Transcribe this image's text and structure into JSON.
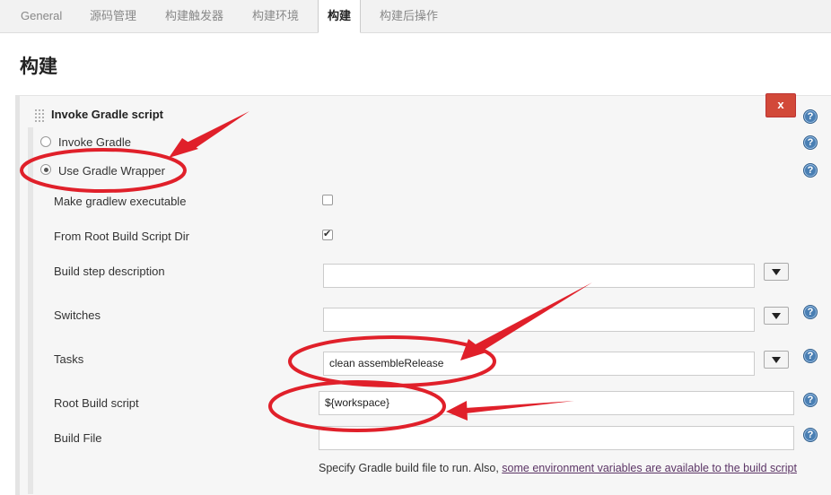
{
  "tabs": [
    {
      "label": "General"
    },
    {
      "label": "源码管理"
    },
    {
      "label": "构建触发器"
    },
    {
      "label": "构建环境"
    },
    {
      "label": "构建"
    },
    {
      "label": "构建后操作"
    }
  ],
  "active_tab": "构建",
  "section_title": "构建",
  "build_step": {
    "title": "Invoke Gradle script",
    "delete_label": "x",
    "options": {
      "invoke_gradle": "Invoke Gradle",
      "use_wrapper": "Use Gradle Wrapper",
      "selected": "Use Gradle Wrapper"
    },
    "make_executable": {
      "label": "Make gradlew executable",
      "checked": false
    },
    "from_root_dir": {
      "label": "From Root Build Script Dir",
      "checked": true,
      "checkmark": "✔"
    },
    "build_step_description": {
      "label": "Build step description",
      "value": ""
    },
    "switches": {
      "label": "Switches",
      "value": ""
    },
    "tasks": {
      "label": "Tasks",
      "value": "clean assembleRelease"
    },
    "root_build_script": {
      "label": "Root Build script",
      "value": "${workspace}"
    },
    "build_file": {
      "label": "Build File",
      "value": "",
      "help_prefix": "Specify Gradle build file to run. Also, ",
      "help_link": "some environment variables are available to the build script"
    }
  },
  "help_glyph": "?",
  "annotation_color": "#e0202a"
}
